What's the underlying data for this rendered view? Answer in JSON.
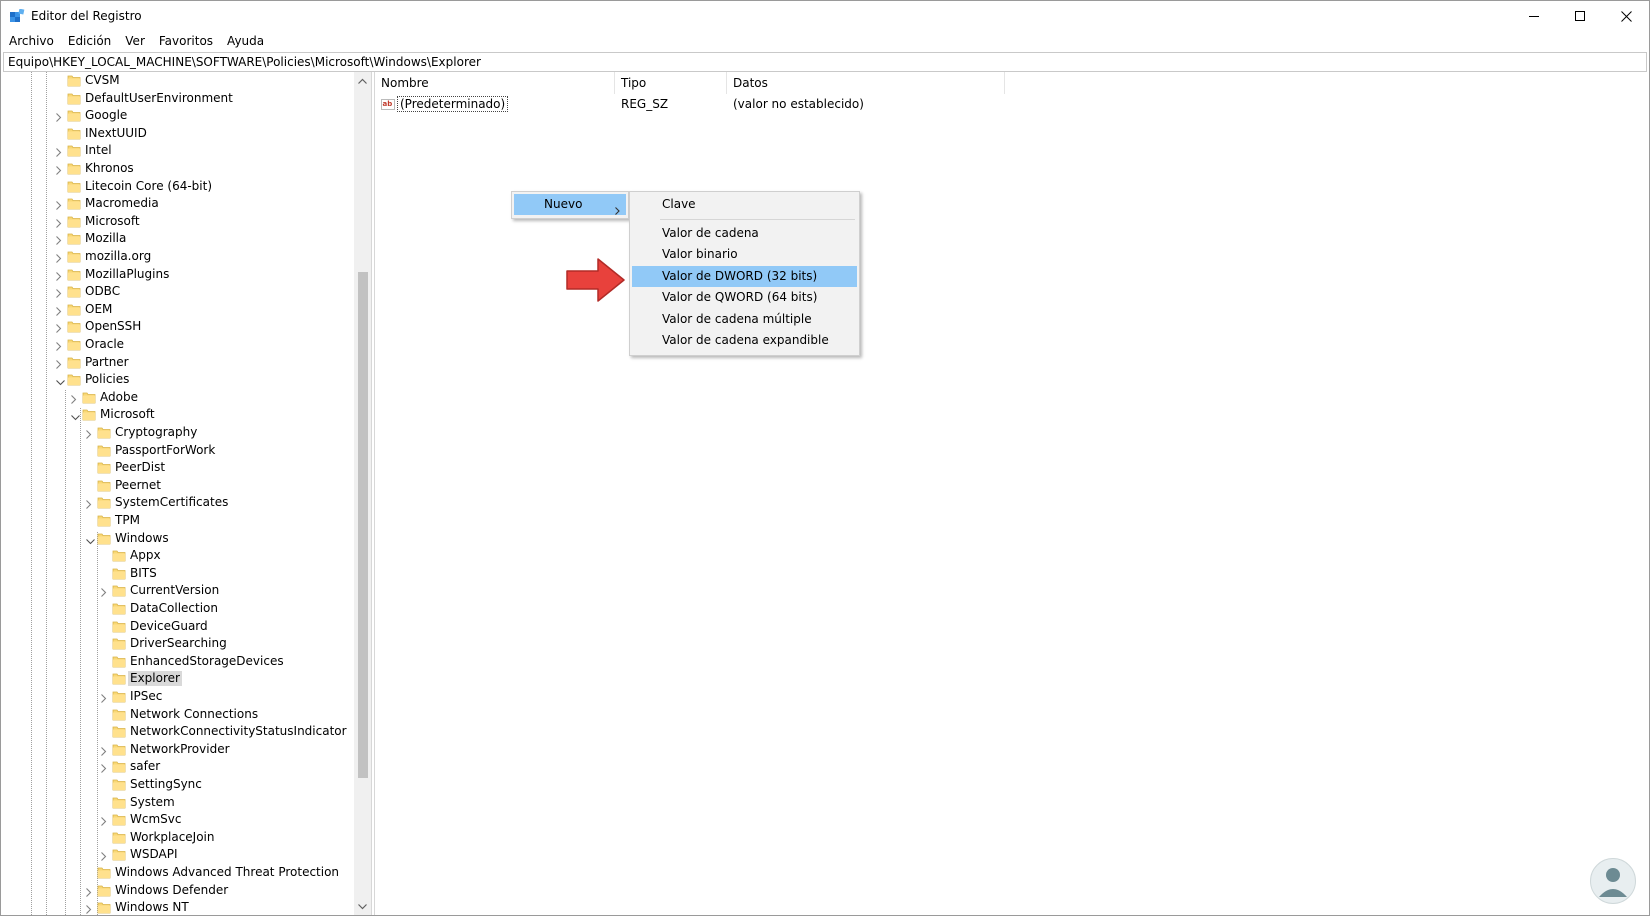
{
  "window": {
    "title": "Editor del Registro",
    "controls": [
      "minimize-icon",
      "maximize-icon",
      "close-icon"
    ]
  },
  "menubar": [
    "Archivo",
    "Edición",
    "Ver",
    "Favoritos",
    "Ayuda"
  ],
  "address": "Equipo\\HKEY_LOCAL_MACHINE\\SOFTWARE\\Policies\\Microsoft\\Windows\\Explorer",
  "tree": {
    "items": [
      {
        "label": "CVSM",
        "level": 0,
        "expander": "none"
      },
      {
        "label": "DefaultUserEnvironment",
        "level": 0,
        "expander": "none"
      },
      {
        "label": "Google",
        "level": 0,
        "expander": "collapsed"
      },
      {
        "label": "INextUUID",
        "level": 0,
        "expander": "none"
      },
      {
        "label": "Intel",
        "level": 0,
        "expander": "collapsed"
      },
      {
        "label": "Khronos",
        "level": 0,
        "expander": "collapsed"
      },
      {
        "label": "Litecoin Core (64-bit)",
        "level": 0,
        "expander": "none"
      },
      {
        "label": "Macromedia",
        "level": 0,
        "expander": "collapsed"
      },
      {
        "label": "Microsoft",
        "level": 0,
        "expander": "collapsed"
      },
      {
        "label": "Mozilla",
        "level": 0,
        "expander": "collapsed"
      },
      {
        "label": "mozilla.org",
        "level": 0,
        "expander": "collapsed"
      },
      {
        "label": "MozillaPlugins",
        "level": 0,
        "expander": "collapsed"
      },
      {
        "label": "ODBC",
        "level": 0,
        "expander": "collapsed"
      },
      {
        "label": "OEM",
        "level": 0,
        "expander": "collapsed"
      },
      {
        "label": "OpenSSH",
        "level": 0,
        "expander": "collapsed"
      },
      {
        "label": "Oracle",
        "level": 0,
        "expander": "collapsed"
      },
      {
        "label": "Partner",
        "level": 0,
        "expander": "collapsed"
      },
      {
        "label": "Policies",
        "level": 0,
        "expander": "expanded"
      },
      {
        "label": "Adobe",
        "level": 1,
        "expander": "collapsed"
      },
      {
        "label": "Microsoft",
        "level": 1,
        "expander": "expanded"
      },
      {
        "label": "Cryptography",
        "level": 2,
        "expander": "collapsed"
      },
      {
        "label": "PassportForWork",
        "level": 2,
        "expander": "none"
      },
      {
        "label": "PeerDist",
        "level": 2,
        "expander": "none"
      },
      {
        "label": "Peernet",
        "level": 2,
        "expander": "none"
      },
      {
        "label": "SystemCertificates",
        "level": 2,
        "expander": "collapsed"
      },
      {
        "label": "TPM",
        "level": 2,
        "expander": "none"
      },
      {
        "label": "Windows",
        "level": 2,
        "expander": "expanded"
      },
      {
        "label": "Appx",
        "level": 3,
        "expander": "none"
      },
      {
        "label": "BITS",
        "level": 3,
        "expander": "none"
      },
      {
        "label": "CurrentVersion",
        "level": 3,
        "expander": "collapsed"
      },
      {
        "label": "DataCollection",
        "level": 3,
        "expander": "none"
      },
      {
        "label": "DeviceGuard",
        "level": 3,
        "expander": "none"
      },
      {
        "label": "DriverSearching",
        "level": 3,
        "expander": "none"
      },
      {
        "label": "EnhancedStorageDevices",
        "level": 3,
        "expander": "none"
      },
      {
        "label": "Explorer",
        "level": 3,
        "expander": "none",
        "selected": true
      },
      {
        "label": "IPSec",
        "level": 3,
        "expander": "collapsed"
      },
      {
        "label": "Network Connections",
        "level": 3,
        "expander": "none"
      },
      {
        "label": "NetworkConnectivityStatusIndicator",
        "level": 3,
        "expander": "none"
      },
      {
        "label": "NetworkProvider",
        "level": 3,
        "expander": "collapsed"
      },
      {
        "label": "safer",
        "level": 3,
        "expander": "collapsed"
      },
      {
        "label": "SettingSync",
        "level": 3,
        "expander": "none"
      },
      {
        "label": "System",
        "level": 3,
        "expander": "none"
      },
      {
        "label": "WcmSvc",
        "level": 3,
        "expander": "collapsed"
      },
      {
        "label": "WorkplaceJoin",
        "level": 3,
        "expander": "none"
      },
      {
        "label": "WSDAPI",
        "level": 3,
        "expander": "collapsed"
      },
      {
        "label": "Windows Advanced Threat Protection",
        "level": 2,
        "expander": "none"
      },
      {
        "label": "Windows Defender",
        "level": 2,
        "expander": "collapsed"
      },
      {
        "label": "Windows NT",
        "level": 2,
        "expander": "collapsed"
      }
    ]
  },
  "list": {
    "columns": [
      "Nombre",
      "Tipo",
      "Datos"
    ],
    "rows": [
      {
        "icon": "string-value-icon",
        "name": "(Predeterminado)",
        "type": "REG_SZ",
        "data": "(valor no establecido)"
      }
    ]
  },
  "context_menu": {
    "parent_item": "Nuevo",
    "submenu": [
      {
        "label": "Clave",
        "highlighted": false
      },
      {
        "separator": true
      },
      {
        "label": "Valor de cadena",
        "highlighted": false
      },
      {
        "label": "Valor binario",
        "highlighted": false
      },
      {
        "label": "Valor de DWORD (32 bits)",
        "highlighted": true
      },
      {
        "label": "Valor de QWORD (64 bits)",
        "highlighted": false
      },
      {
        "label": "Valor de cadena múltiple",
        "highlighted": false
      },
      {
        "label": "Valor de cadena expandible",
        "highlighted": false
      }
    ]
  },
  "annotations": {
    "arrow_color": "#e8413c",
    "arrow_icon": "red-arrow-icon"
  },
  "colors": {
    "menu_highlight": "#91c9f7",
    "folder_yellow": "#f8d775",
    "selection_gray": "#d9d9d9"
  }
}
